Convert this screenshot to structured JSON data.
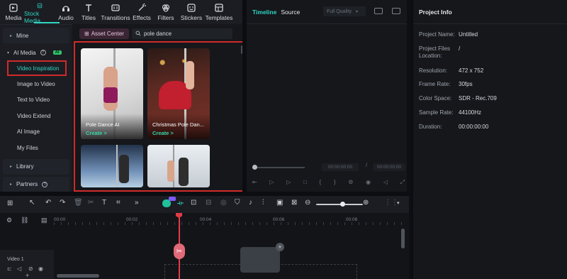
{
  "top_tabs": [
    {
      "label": "Media",
      "icon": "media-icon"
    },
    {
      "label": "Stock Media",
      "icon": "stock-media-icon"
    },
    {
      "label": "Audio",
      "icon": "audio-icon"
    },
    {
      "label": "Titles",
      "icon": "titles-icon"
    },
    {
      "label": "Transitions",
      "icon": "transitions-icon"
    },
    {
      "label": "Effects",
      "icon": "effects-icon"
    },
    {
      "label": "Filters",
      "icon": "filters-icon"
    },
    {
      "label": "Stickers",
      "icon": "stickers-icon"
    },
    {
      "label": "Templates",
      "icon": "templates-icon"
    }
  ],
  "active_tab": "Stock Media",
  "accent_color": "#2fd6c5",
  "highlight_color": "#d12a2a",
  "left_nav": {
    "mine": "Mine",
    "ai_media": "AI Media",
    "ai_badge": "AI",
    "items": [
      "Video Inspiration",
      "Image to Video",
      "Text to Video",
      "Video Extend",
      "AI Image",
      "My Files"
    ],
    "library": "Library",
    "partners": "Partners"
  },
  "search": {
    "asset_center": "Asset Center",
    "query": "pole dance"
  },
  "cards": [
    {
      "title": "Pole Dance AI",
      "action": "Create >"
    },
    {
      "title": "Christmas Pole Dan...",
      "action": "Create >"
    }
  ],
  "preview": {
    "timeline_tab": "Timeline",
    "source_tab": "Source",
    "quality": "Full Quality",
    "current_time": "00:00:00:00",
    "separator": "/",
    "total_time": "00:00:00:00"
  },
  "project_info": {
    "title": "Project Info",
    "rows": [
      {
        "label": "Project Name:",
        "value": "Untitled"
      },
      {
        "label": "Project Files Location:",
        "value": "/"
      },
      {
        "label": "Resolution:",
        "value": "472 x 752"
      },
      {
        "label": "Frame Rate:",
        "value": "30fps"
      },
      {
        "label": "Color Space:",
        "value": "SDR - Rec.709"
      },
      {
        "label": "Sample Rate:",
        "value": "44100Hz"
      },
      {
        "label": "Duration:",
        "value": "00:00:00:00"
      }
    ]
  },
  "timeline": {
    "ruler": [
      "00:00",
      "00:02",
      "00:04",
      "00:06",
      "00:08"
    ],
    "track_label": "Video 1"
  }
}
